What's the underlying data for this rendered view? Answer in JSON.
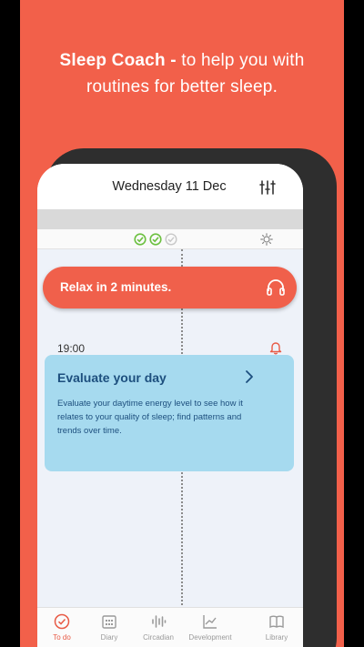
{
  "headline": {
    "bold": "Sleep Coach -",
    "line1_rest": " to help you with",
    "line2": "routines for better sleep."
  },
  "header": {
    "date": "Wednesday 11 Dec"
  },
  "progress": {
    "checks_done": 2,
    "checks_total": 3
  },
  "relax_banner": {
    "label": "Relax in 2 minutes."
  },
  "schedule": {
    "time": "19:00"
  },
  "card": {
    "title": "Evaluate your day",
    "body": "Evaluate your daytime energy level to see how it relates to your quality of sleep; find patterns and trends over time."
  },
  "nav": {
    "items": [
      {
        "label": "To do",
        "icon": "clock-check-icon",
        "active": true
      },
      {
        "label": "Diary",
        "icon": "calendar-icon",
        "active": false
      },
      {
        "label": "Circadian",
        "icon": "wave-bars-icon",
        "active": false
      },
      {
        "label": "Development",
        "icon": "line-chart-icon",
        "active": false
      },
      {
        "label": "Library",
        "icon": "book-icon",
        "active": false
      }
    ]
  },
  "colors": {
    "background": "#f2604a",
    "accent": "#f0604b",
    "card": "#a6daef",
    "check": "#6cc040"
  }
}
